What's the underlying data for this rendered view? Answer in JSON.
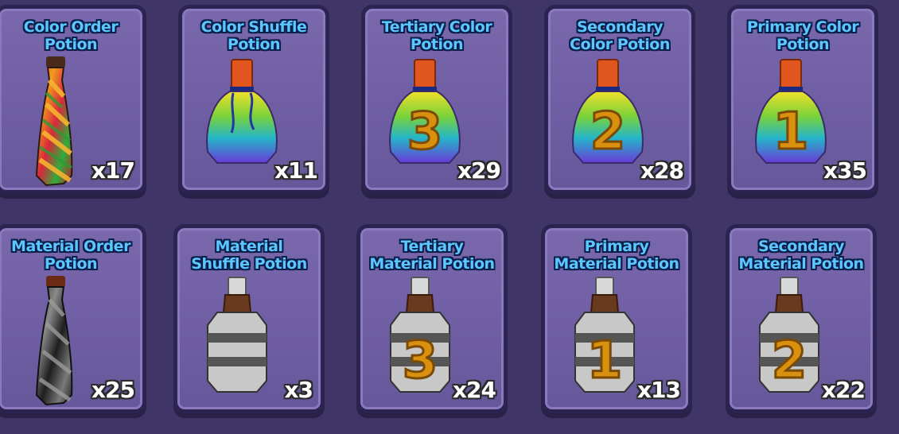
{
  "inventory": {
    "row1": [
      {
        "name": "Color Order\nPotion",
        "count": "x17",
        "icon": "twisted-rainbow-potion-icon"
      },
      {
        "name": "Color Shuffle\nPotion",
        "count": "x11",
        "icon": "rainbow-potion-icon"
      },
      {
        "name": "Tertiary Color\nPotion",
        "count": "x29",
        "icon": "rainbow-potion-3-icon",
        "digit": "3"
      },
      {
        "name": "Secondary\nColor Potion",
        "count": "x28",
        "icon": "rainbow-potion-2-icon",
        "digit": "2"
      },
      {
        "name": "Primary Color\nPotion",
        "count": "x35",
        "icon": "rainbow-potion-1-icon",
        "digit": "1"
      }
    ],
    "row2": [
      {
        "name": "Material Order\nPotion",
        "count": "x25",
        "icon": "twisted-grey-potion-icon"
      },
      {
        "name": "Material\nShuffle Potion",
        "count": "x3",
        "icon": "grey-potion-icon"
      },
      {
        "name": "Tertiary\nMaterial Potion",
        "count": "x24",
        "icon": "grey-potion-3-icon",
        "digit": "3"
      },
      {
        "name": "Primary\nMaterial Potion",
        "count": "x13",
        "icon": "grey-potion-1-icon",
        "digit": "1"
      },
      {
        "name": "Secondary\nMaterial Potion",
        "count": "x22",
        "icon": "grey-potion-2-icon",
        "digit": "2"
      }
    ]
  },
  "colors": {
    "background": "#3f3566",
    "card": "#6f5ea3",
    "title": "#5cc6ff",
    "digit": "#d9900f"
  }
}
